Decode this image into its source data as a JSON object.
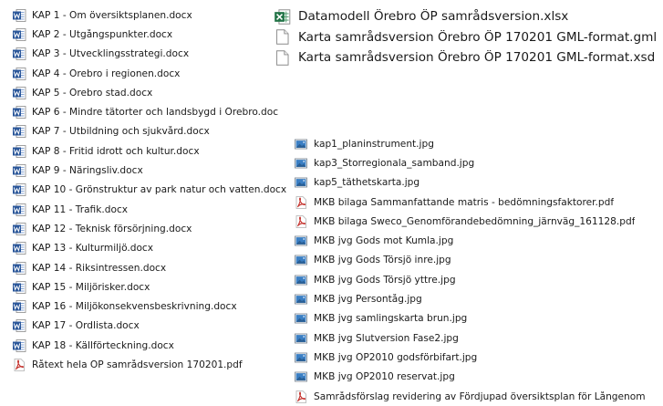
{
  "colors": {
    "word_blue": "#2b579a",
    "excel_green": "#217346",
    "pdf_red": "#c4302b",
    "image_blue": "#3b7fc4"
  },
  "docx_column": [
    {
      "name": "KAP 1 - Om översiktsplanen.docx",
      "icon": "word-doc-icon"
    },
    {
      "name": "KAP 2 - Utgångspunkter.docx",
      "icon": "word-doc-icon"
    },
    {
      "name": "KAP 3 - Utvecklingsstrategi.docx",
      "icon": "word-doc-icon"
    },
    {
      "name": "KAP 4 - Örebro i regionen.docx",
      "icon": "word-doc-icon"
    },
    {
      "name": "KAP 5 - Örebro stad.docx",
      "icon": "word-doc-icon"
    },
    {
      "name": "KAP 6 - Mindre tätorter och landsbygd i Örebro.doc",
      "icon": "word-doc-icon"
    },
    {
      "name": "KAP 7 - Utbildning och sjukvård.docx",
      "icon": "word-doc-icon"
    },
    {
      "name": "KAP 8 - Fritid idrott och kultur.docx",
      "icon": "word-doc-icon"
    },
    {
      "name": "KAP 9 - Näringsliv.docx",
      "icon": "word-doc-icon"
    },
    {
      "name": "KAP 10 - Grönstruktur av park natur och vatten.docx",
      "icon": "word-doc-icon"
    },
    {
      "name": "KAP 11 - Trafik.docx",
      "icon": "word-doc-icon"
    },
    {
      "name": "KAP 12 - Teknisk försörjning.docx",
      "icon": "word-doc-icon"
    },
    {
      "name": "KAP 13 - Kulturmiljö.docx",
      "icon": "word-doc-icon"
    },
    {
      "name": "KAP 14 - Riksintressen.docx",
      "icon": "word-doc-icon"
    },
    {
      "name": "KAP 15 - Miljörisker.docx",
      "icon": "word-doc-icon"
    },
    {
      "name": "KAP 16 - Miljökonsekvensbeskrivning.docx",
      "icon": "word-doc-icon"
    },
    {
      "name": "KAP 17 - Ordlista.docx",
      "icon": "word-doc-icon"
    },
    {
      "name": "KAP 18 - Källförteckning.docx",
      "icon": "word-doc-icon"
    },
    {
      "name": "Råtext hela ÖP samrådsversion 170201.pdf",
      "icon": "pdf-icon"
    }
  ],
  "large_column": [
    {
      "name": "Datamodell Örebro ÖP samrådsversion.xlsx",
      "icon": "excel-icon"
    },
    {
      "name": "Karta samrådsversion Örebro ÖP 170201 GML-format.gml",
      "icon": "blank-file-icon"
    },
    {
      "name": "Karta samrådsversion Örebro ÖP 170201 GML-format.xsd",
      "icon": "blank-file-icon"
    }
  ],
  "small_column": [
    {
      "name": "kap1_planinstrument.jpg",
      "icon": "image-icon"
    },
    {
      "name": "kap3_Storregionala_samband.jpg",
      "icon": "image-icon"
    },
    {
      "name": "kap5_täthetskarta.jpg",
      "icon": "image-icon"
    },
    {
      "name": "MKB bilaga Sammanfattande matris - bedömningsfaktorer.pdf",
      "icon": "pdf-icon"
    },
    {
      "name": "MKB bilaga Sweco_Genomförandebedömning_järnväg_161128.pdf",
      "icon": "pdf-icon"
    },
    {
      "name": "MKB jvg Gods mot Kumla.jpg",
      "icon": "image-icon"
    },
    {
      "name": "MKB jvg Gods Törsjö inre.jpg",
      "icon": "image-icon"
    },
    {
      "name": "MKB jvg Gods Törsjö yttre.jpg",
      "icon": "image-icon"
    },
    {
      "name": "MKB jvg Persontåg.jpg",
      "icon": "image-icon"
    },
    {
      "name": "MKB jvg samlingskarta brun.jpg",
      "icon": "image-icon"
    },
    {
      "name": "MKB jvg Slutversion Fase2.jpg",
      "icon": "image-icon"
    },
    {
      "name": "MKB jvg ÖP2010 godsförbifart.jpg",
      "icon": "image-icon"
    },
    {
      "name": "MKB jvg ÖP2010 reservat.jpg",
      "icon": "image-icon"
    },
    {
      "name": "Samrådsförslag revidering av Fördjupad översiktsplan för Långenom",
      "icon": "pdf-icon"
    }
  ]
}
